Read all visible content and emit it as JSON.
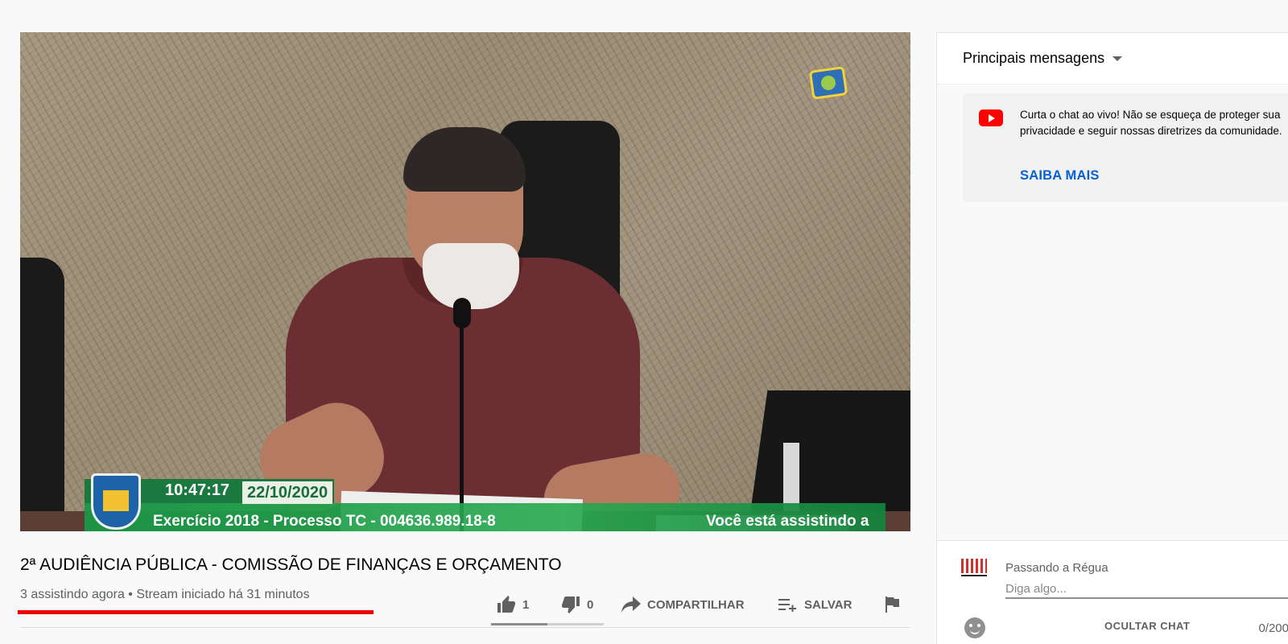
{
  "video": {
    "clock": "10:47:17",
    "date": "22/10/2020",
    "process_line": "Exercício 2018 - Processo TC - 004636.989.18-8",
    "ticker_text": "Você está assistindo a"
  },
  "title": "2ª AUDIÊNCIA PÚBLICA - COMISSÃO DE FINANÇAS E ORÇAMENTO",
  "meta": "3 assistindo agora • Stream iniciado há 31 minutos",
  "actions": {
    "likes": "1",
    "dislikes": "0",
    "share_label": "COMPARTILHAR",
    "save_label": "SALVAR",
    "like_ratio": 1.0
  },
  "chat": {
    "header": "Principais mensagens",
    "notice_text": "Curta o chat ao vivo! Não se esqueça de proteger sua privacidade e seguir nossas diretrizes da comunidade.",
    "learn_more": "SAIBA MAIS",
    "user_name": "Passando a Régua",
    "input_placeholder": "Diga algo...",
    "char_count": "0/200",
    "hide_chat": "OCULTAR CHAT"
  },
  "colors": {
    "accent_link": "#065fd4",
    "annotation_underline": "#ee0000",
    "overlay_green": "#18964a"
  },
  "icons": [
    "like-icon",
    "dislike-icon",
    "share-icon",
    "save-to-playlist-icon",
    "report-flag-icon",
    "youtube-icon",
    "emoji-icon",
    "dropdown-caret-icon"
  ]
}
